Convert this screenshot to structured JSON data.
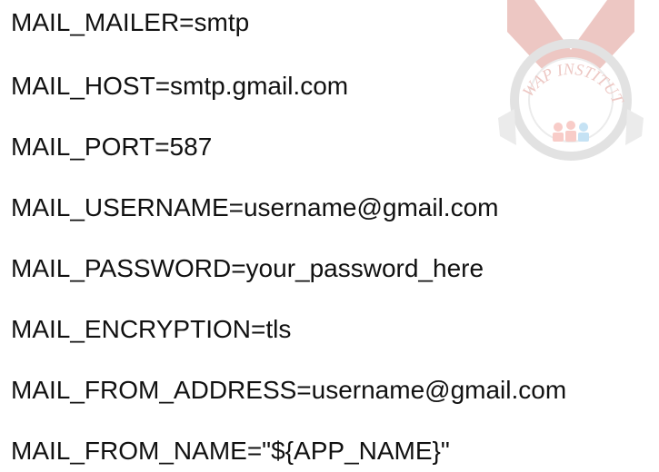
{
  "lines": [
    "MAIL_MAILER=smtp",
    "MAIL_HOST=smtp.gmail.com",
    "MAIL_PORT=587",
    "MAIL_USERNAME=username@gmail.com",
    "MAIL_PASSWORD=your_password_here",
    "MAIL_ENCRYPTION=tls",
    "MAIL_FROM_ADDRESS=username@gmail.com",
    "MAIL_FROM_NAME=\"${APP_NAME}\""
  ],
  "watermark": {
    "text": "WAP INSTITUTE",
    "icon": "institute-logo-watermark",
    "color": "#c0392b"
  }
}
